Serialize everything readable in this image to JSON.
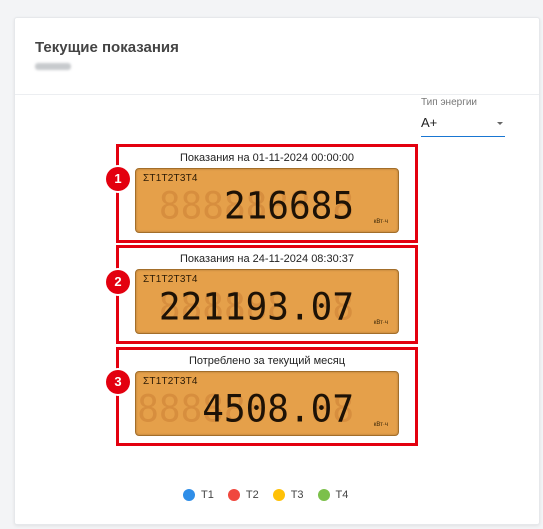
{
  "card": {
    "title": "Текущие показания",
    "subtitle": "07844"
  },
  "energy_type": {
    "label": "Тип энергии",
    "value": "A+"
  },
  "panels": [
    {
      "badge": "1",
      "caption": "Показания на 01-11-2024 00:00:00",
      "tariffs": "ΣT1T2T3T4",
      "reading": "216685",
      "ghost": "888888888",
      "unit": "кВт·ч"
    },
    {
      "badge": "2",
      "caption": "Показания на 24-11-2024 08:30:37",
      "tariffs": "ΣT1T2T3T4",
      "reading": "221193.07",
      "ghost": "888888.88",
      "unit": "кВт·ч"
    },
    {
      "badge": "3",
      "caption": "Потреблено за текущий месяц",
      "tariffs": "ΣT1T2T3T4",
      "reading": "4508.07",
      "ghost": "88888888.88",
      "unit": "кВт·ч"
    }
  ],
  "legend": [
    {
      "label": "T1",
      "color": "#2f8ee8"
    },
    {
      "label": "T2",
      "color": "#f0483e"
    },
    {
      "label": "T3",
      "color": "#ffc107"
    },
    {
      "label": "T4",
      "color": "#7cc04b"
    }
  ],
  "colors": {
    "accent": "#1976d2",
    "highlight": "#e3000f",
    "lcd": "#e5a04a"
  }
}
